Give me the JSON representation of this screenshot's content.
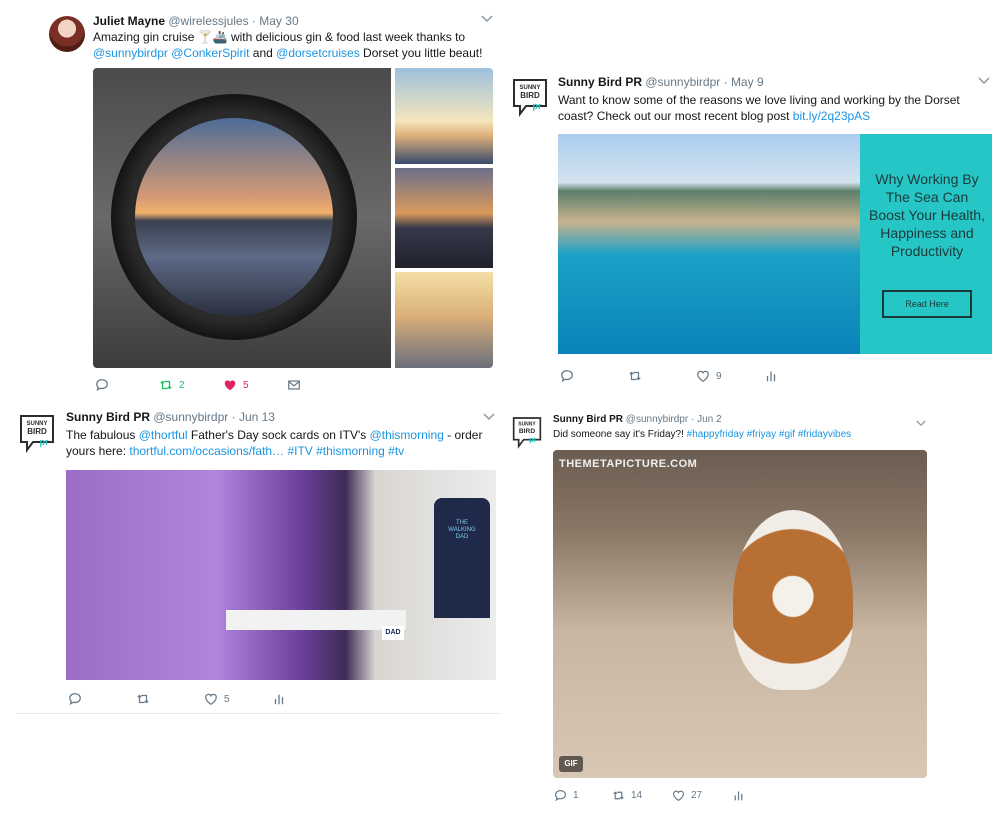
{
  "colors": {
    "link": "#1b95e0",
    "like_active": "#e0245e",
    "retweet_active": "#17bf63",
    "muted": "#657786"
  },
  "tweets": [
    {
      "name": "Juliet Mayne",
      "handle": "@wirelessjules",
      "date": "May 30",
      "text": {
        "line1_before": "Amazing gin cruise ",
        "emoji": "🍸🚢",
        "line1_after": " with delicious gin & food last week thanks to",
        "mention1": "@sunnybirdpr",
        "mention2": "@ConkerSpirit",
        "and": " and ",
        "mention3": "@dorsetcruises",
        "tail": " Dorset you little beaut!"
      },
      "actions": {
        "reply": "",
        "retweet": "2",
        "like": "5"
      }
    },
    {
      "name": "Sunny Bird PR",
      "handle": "@sunnybirdpr",
      "date": "May 9",
      "text": {
        "line1": "Want to know some of the reasons we love living and working by the Dorset",
        "line2_before": "coast? Check out our most recent blog post ",
        "link": "bit.ly/2q23pAS"
      },
      "card": {
        "title": "Why Working By The Sea Can Boost Your Health, Happiness and Productivity",
        "button": "Read Here"
      },
      "actions": {
        "reply": "",
        "retweet": "",
        "like": "9"
      }
    },
    {
      "name": "Sunny Bird PR",
      "handle": "@sunnybirdpr",
      "date": "Jun 13",
      "text": {
        "before": "The fabulous ",
        "mention1": "@thortful",
        "mid": " Father's Day sock cards on ITV's ",
        "mention2": "@thismorning",
        "dash": " - order",
        "line2_before": "yours here: ",
        "link": "thortful.com/occasions/fath…",
        "tags": " #ITV #thismorning #tv"
      },
      "media": {
        "shirt_text": "THE WALKING DAD",
        "box_text": "DAD"
      },
      "actions": {
        "reply": "",
        "retweet": "",
        "like": "5"
      }
    },
    {
      "name": "Sunny Bird PR",
      "handle": "@sunnybirdpr",
      "date": "Jun 2",
      "text": {
        "before": "Did someone say it's Friday?! ",
        "tags": "#happyfriday #friyay #gif #fridayvibes"
      },
      "media": {
        "watermark": "THEMETAPICTURE.COM",
        "badge": "GIF"
      },
      "actions": {
        "reply": "1",
        "retweet": "14",
        "like": "27"
      }
    }
  ],
  "logo": {
    "line1": "SUNNY",
    "line2": "BIRD",
    "line3": "pr"
  },
  "separator": "·"
}
